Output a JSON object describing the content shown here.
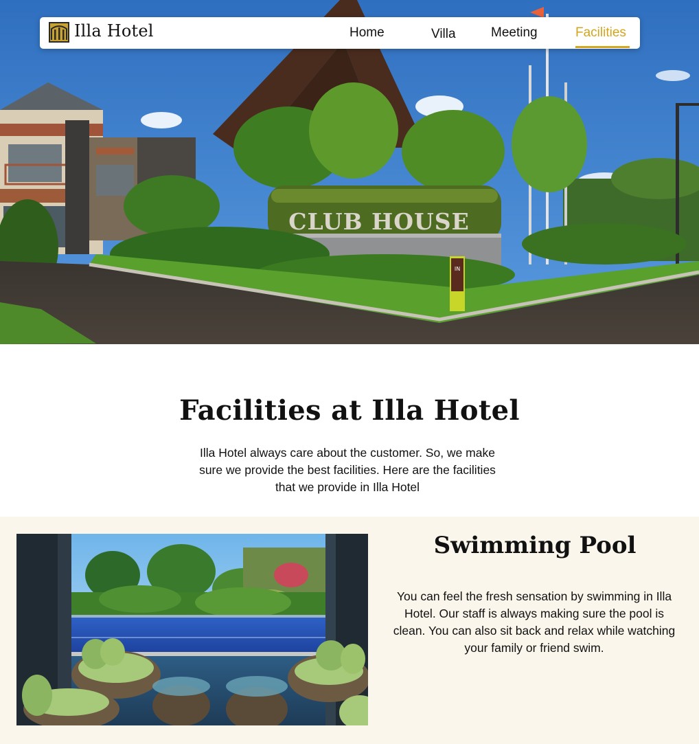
{
  "header": {
    "brand": "Illa Hotel",
    "nav": [
      {
        "label": "Home",
        "active": false
      },
      {
        "label": "Villa",
        "active": false
      },
      {
        "label": "Meeting",
        "active": false
      },
      {
        "label": "Facilities",
        "active": true
      }
    ]
  },
  "hero": {
    "sign_text": "CLUB HOUSE",
    "post_text": "IN"
  },
  "intro": {
    "title": "Facilities at Illa Hotel",
    "text": "Illa Hotel always care about the customer. So, we make sure we provide the best facilities. Here are the facilities that we provide in Illa Hotel"
  },
  "facilities": [
    {
      "title": "Swimming Pool",
      "text": "You can feel the fresh sensation by swimming in Illa Hotel. Our staff is always making sure the pool is clean. You can also sit back and relax while watching your family or friend swim."
    }
  ],
  "colors": {
    "accent": "#d4a51c",
    "section_bg": "#fbf6ec",
    "text": "#111111"
  }
}
